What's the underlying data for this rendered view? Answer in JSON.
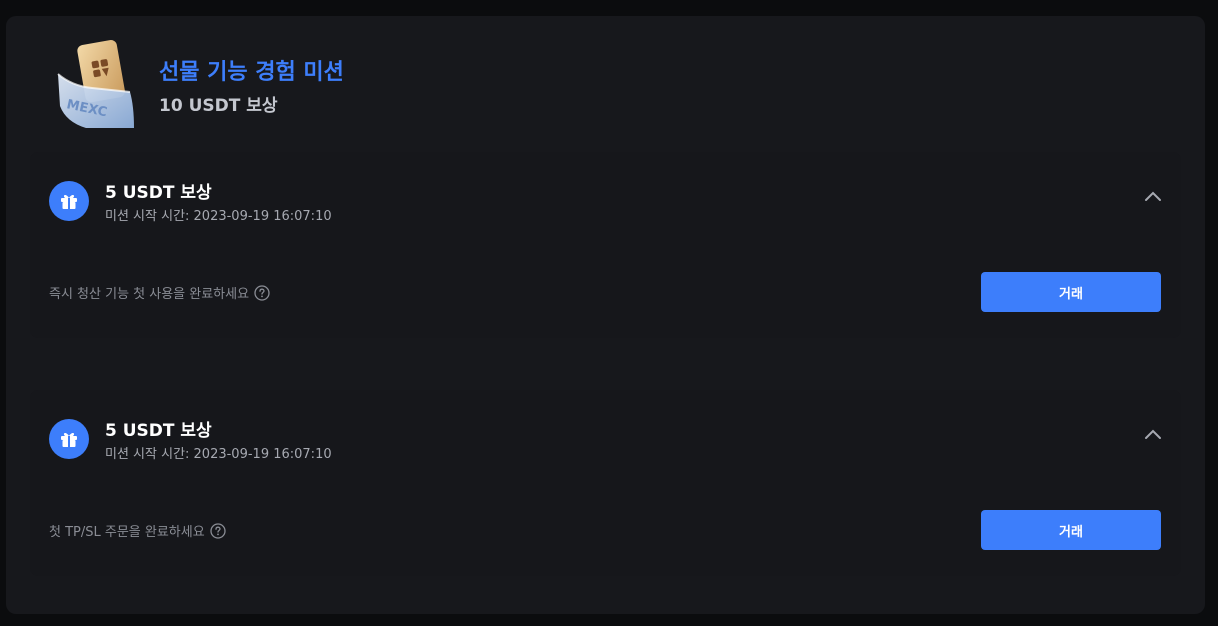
{
  "header": {
    "title": "선물 기능 경험 미션",
    "subtitle": "10 USDT 보상",
    "logo_icon": "mexc-card-wallet-icon",
    "logo_text": "MEXC"
  },
  "colors": {
    "accent": "#3d7efb",
    "panel_bg": "#17181c",
    "page_bg": "#0b0c0e",
    "muted_text": "#8a8d95"
  },
  "missions": [
    {
      "reward_title": "5 USDT 보상",
      "start_time": "미션 시작 시간: 2023-09-19 16:07:10",
      "task": "즉시 청산 기능 첫 사용을 완료하세요",
      "button_label": "거래",
      "icon": "gift-icon",
      "expanded": true
    },
    {
      "reward_title": "5 USDT 보상",
      "start_time": "미션 시작 시간: 2023-09-19 16:07:10",
      "task": "첫 TP/SL 주문을 완료하세요",
      "button_label": "거래",
      "icon": "gift-icon",
      "expanded": true
    }
  ]
}
